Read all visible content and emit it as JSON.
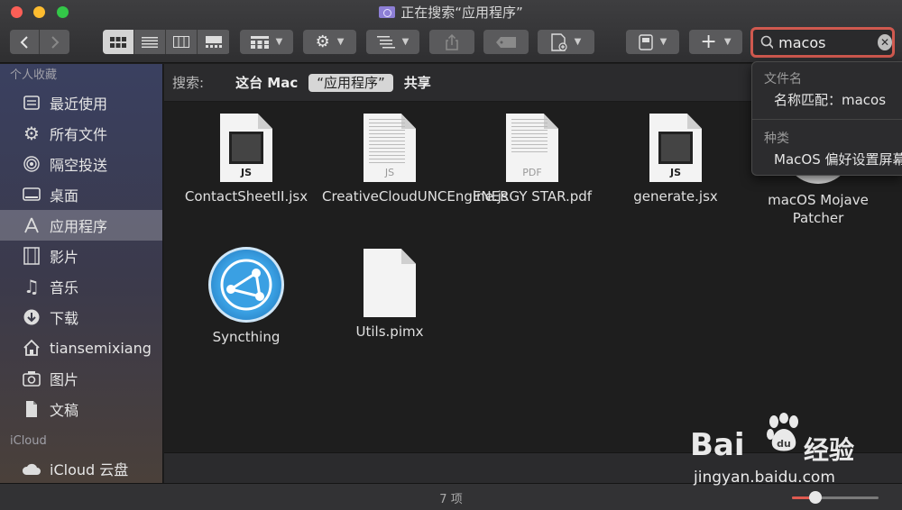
{
  "window": {
    "title": "正在搜索“应用程序”"
  },
  "search": {
    "value": "macos"
  },
  "sidebar": {
    "favorites_header": "个人收藏",
    "items": [
      {
        "label": "最近使用",
        "icon": "recents-icon"
      },
      {
        "label": "所有文件",
        "icon": "gear-icon"
      },
      {
        "label": "隔空投送",
        "icon": "airdrop-icon"
      },
      {
        "label": "桌面",
        "icon": "desktop-icon"
      },
      {
        "label": "应用程序",
        "icon": "applications-icon",
        "active": true
      },
      {
        "label": "影片",
        "icon": "film-icon"
      },
      {
        "label": "音乐",
        "icon": "music-icon"
      },
      {
        "label": "下载",
        "icon": "download-icon"
      },
      {
        "label": "tiansemixiang",
        "icon": "home-icon"
      },
      {
        "label": "图片",
        "icon": "camera-icon"
      },
      {
        "label": "文稿",
        "icon": "documents-icon"
      }
    ],
    "icloud_header": "iCloud",
    "icloud_items": [
      {
        "label": "iCloud 云盘",
        "icon": "cloud-icon"
      }
    ]
  },
  "scopebar": {
    "label": "搜索:",
    "scopes": [
      {
        "label": "这台 Mac",
        "selected": false
      },
      {
        "label": "“应用程序”",
        "selected": true
      },
      {
        "label": "共享",
        "selected": false
      }
    ]
  },
  "files": [
    {
      "name": "ContactSheetII.jsx",
      "kind": "js",
      "tag": "JS"
    },
    {
      "name": "CreativeCloudUNCEngine.js",
      "kind": "text",
      "tag": "JS"
    },
    {
      "name": "ENERGY STAR.pdf",
      "kind": "pdf",
      "tag": "PDF"
    },
    {
      "name": "generate.jsx",
      "kind": "js",
      "tag": "JS"
    },
    {
      "name": "macOS Mojave Patcher",
      "kind": "app"
    },
    {
      "name": "Syncthing",
      "kind": "app"
    },
    {
      "name": "Utils.pimx",
      "kind": "blank"
    }
  ],
  "status": {
    "count": "7 项",
    "zoom_level": 0.27
  },
  "popover": {
    "filename_header": "文件名",
    "filename_item": "名称匹配：macos",
    "kind_header": "种类",
    "kind_item": "MacOS 偏好设置屏幕"
  },
  "watermark": {
    "brand": "Bai",
    "brand_cn": "经验",
    "url": "jingyan.baidu.com"
  },
  "colors": {
    "accent": "#d0594f",
    "sidebar_active": "#5a5a66"
  }
}
